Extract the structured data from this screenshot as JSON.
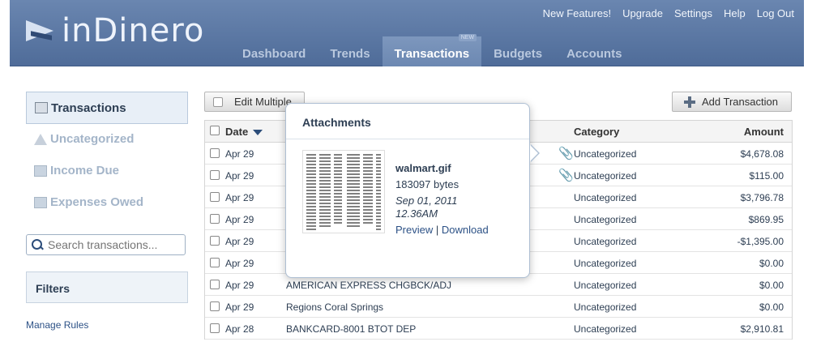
{
  "header": {
    "logo": "inDinero",
    "top_links": [
      "New Features!",
      "Upgrade",
      "Settings",
      "Help",
      "Log Out"
    ],
    "nav": [
      {
        "label": "Dashboard",
        "active": false
      },
      {
        "label": "Trends",
        "active": false
      },
      {
        "label": "Transactions",
        "active": true,
        "badge": "NEW"
      },
      {
        "label": "Budgets",
        "active": false
      },
      {
        "label": "Accounts",
        "active": false
      }
    ]
  },
  "sidebar": {
    "items": [
      {
        "label": "Transactions",
        "icon": "transactions-icon",
        "active": true
      },
      {
        "label": "Uncategorized",
        "icon": "warning-icon",
        "active": false
      },
      {
        "label": "Income Due",
        "icon": "income-icon",
        "active": false
      },
      {
        "label": "Expenses Owed",
        "icon": "expenses-icon",
        "active": false
      }
    ],
    "search_placeholder": "Search transactions...",
    "filters_label": "Filters",
    "manage_rules": "Manage Rules"
  },
  "toolbar": {
    "edit_multiple": "Edit Multiple",
    "add_transaction": "Add Transaction"
  },
  "table": {
    "headers": {
      "date": "Date",
      "category": "Category",
      "amount": "Amount"
    },
    "rows": [
      {
        "date": "Apr 29",
        "description": "",
        "attachment": true,
        "category": "Uncategorized",
        "amount": "$4,678.08"
      },
      {
        "date": "Apr 29",
        "description": "",
        "attachment": true,
        "category": "Uncategorized",
        "amount": "$115.00"
      },
      {
        "date": "Apr 29",
        "description": "",
        "attachment": false,
        "category": "Uncategorized",
        "amount": "$3,796.78"
      },
      {
        "date": "Apr 29",
        "description": "",
        "attachment": false,
        "category": "Uncategorized",
        "amount": "$869.95"
      },
      {
        "date": "Apr 29",
        "description": "",
        "attachment": false,
        "category": "Uncategorized",
        "amount": "-$1,395.00"
      },
      {
        "date": "Apr 29",
        "description": "",
        "attachment": false,
        "category": "Uncategorized",
        "amount": "$0.00"
      },
      {
        "date": "Apr 29",
        "description": "AMERICAN EXPRESS CHGBCK/ADJ",
        "attachment": false,
        "category": "Uncategorized",
        "amount": "$0.00"
      },
      {
        "date": "Apr 29",
        "description": "Regions Coral Springs",
        "attachment": false,
        "category": "Uncategorized",
        "amount": "$0.00"
      },
      {
        "date": "Apr 28",
        "description": "BANKCARD-8001 BTOT DEP",
        "attachment": false,
        "category": "Uncategorized",
        "amount": "$2,910.81"
      }
    ]
  },
  "popover": {
    "title": "Attachments",
    "file_name": "walmart.gif",
    "file_size": "183097 bytes",
    "file_date": "Sep 01, 2011 12.36AM",
    "preview": "Preview",
    "separator": "|",
    "download": "Download"
  }
}
